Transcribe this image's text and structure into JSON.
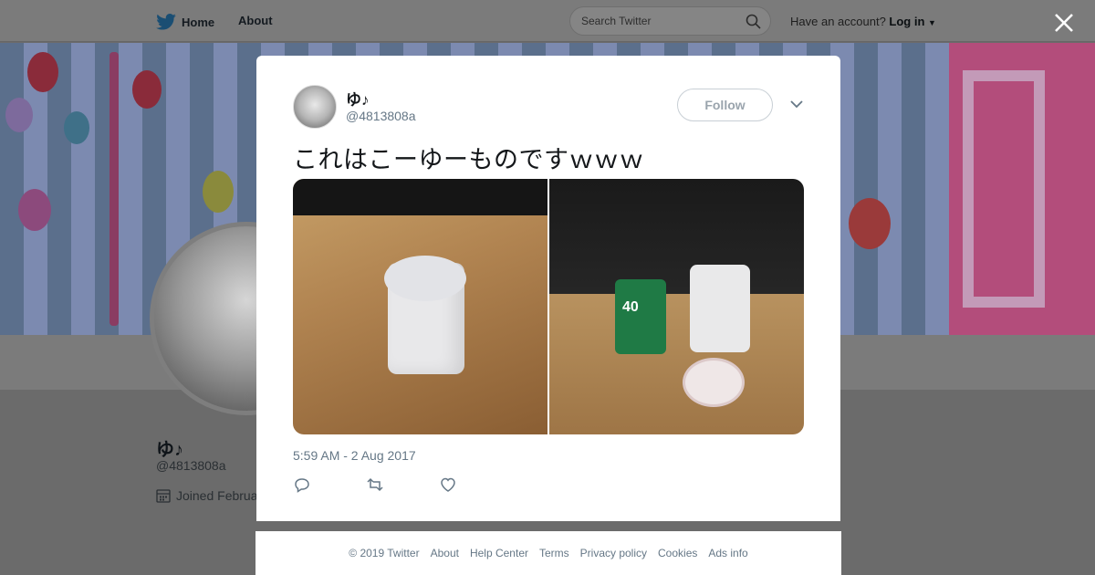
{
  "nav": {
    "home_label": "Home",
    "about_label": "About"
  },
  "search": {
    "placeholder": "Search Twitter"
  },
  "account": {
    "prompt": "Have an account?",
    "login_label": "Log in"
  },
  "background_profile": {
    "name": "ゆ♪",
    "handle": "@4813808a",
    "joined_text": "Joined Februa"
  },
  "tweet": {
    "author_name": "ゆ♪",
    "author_handle": "@4813808a",
    "follow_label": "Follow",
    "text": "これはこーゆーものですｗｗｗ",
    "timestamp": "5:59 AM - 2 Aug 2017",
    "photo2_label": "40"
  },
  "footer": {
    "links": [
      "© 2019 Twitter",
      "About",
      "Help Center",
      "Terms",
      "Privacy policy",
      "Cookies",
      "Ads info"
    ]
  },
  "colors": {
    "link_blue": "#1da1f2",
    "text_gray": "#657786"
  }
}
